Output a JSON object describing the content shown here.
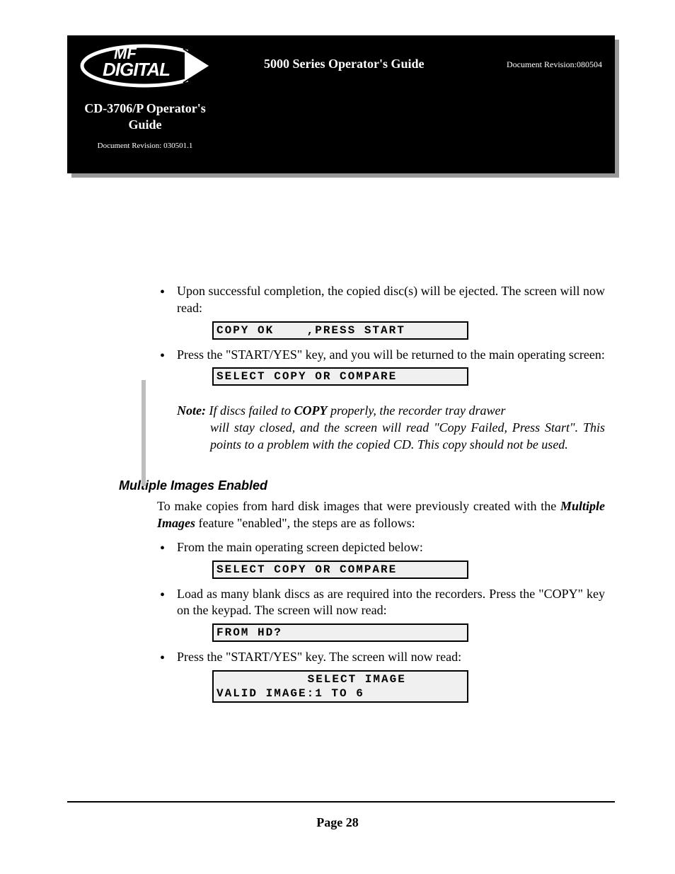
{
  "header": {
    "cd_guide_line1": "CD-3706/P Operator's",
    "cd_guide_line2": "Guide",
    "doc_rev_small": "Document Revision: 030501.1",
    "series_title": "5000 Series Operator's Guide",
    "doc_rev_right": "Document Revision:080504"
  },
  "body": {
    "bullet1": "Upon successful completion, the copied disc(s) will be ejected. The screen will now read:",
    "lcd1": "COPY OK    ,PRESS START",
    "bullet2": "Press the \"START/YES\" key, and you will be returned to the main operating screen:",
    "lcd2": "SELECT COPY OR COMPARE",
    "note_label": "Note:",
    "note_part1": " If discs failed to ",
    "note_copy": "COPY",
    "note_part2": " properly, the recorder tray drawer ",
    "note_part3": "will stay closed, and the screen will read \"Copy Failed, Press Start\". This points to a problem with the copied CD.  This copy should not be used.",
    "section_title": "Multiple Images Enabled",
    "intro_part1": "To make copies from hard disk images that were previously created with the ",
    "intro_em": "Multiple Images",
    "intro_part2": " feature \"enabled\", the steps are as follows:",
    "bullet3": "From the main operating screen depicted below:",
    "lcd3": "SELECT COPY OR COMPARE",
    "bullet4": "Load as many blank discs as are required into the recorders. Press the \"COPY\" key on the keypad. The screen will now read:",
    "lcd4": "FROM HD?",
    "bullet5": "Press the \"START/YES\" key. The screen will now read:",
    "lcd5_line1": "    SELECT IMAGE",
    "lcd5_line2": "VALID IMAGE:1 TO 6"
  },
  "footer": {
    "page_num": "Page 28"
  }
}
